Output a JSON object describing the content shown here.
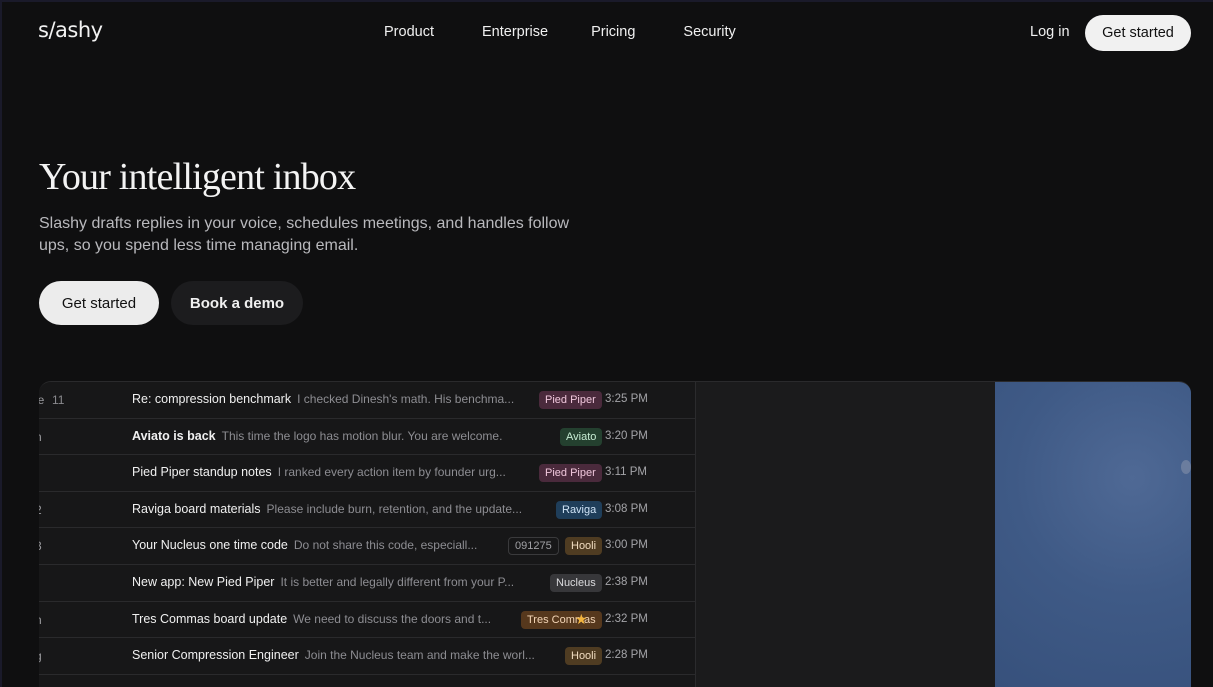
{
  "nav": {
    "logo": "s/ashy",
    "links": [
      "Product",
      "Enterprise",
      "Pricing",
      "Security"
    ],
    "login": "Log in",
    "cta": "Get started"
  },
  "hero": {
    "title": "Your intelligent inbox",
    "subtitle": "Slashy drafts replies in your voice, schedules meetings, and handles follow ups, so you spend less time managing email.",
    "primary_button": "Get started",
    "secondary_button": "Book a demo"
  },
  "emails": [
    {
      "left": "le",
      "count": "11",
      "subject": "Re: compression benchmark",
      "snippet": "I checked Dinesh's math. His benchma...",
      "tag": "Pied Piper",
      "tag_color": "#4a2a3c",
      "tag_text": "#f0c7dc",
      "time": "3:25 PM",
      "bold": false
    },
    {
      "left": "n",
      "count": "",
      "subject": "Aviato is back",
      "snippet": "This time the logo has motion blur. You are welcome.",
      "tag": "Aviato",
      "tag_color": "#24402f",
      "tag_text": "#c6ecd3",
      "time": "3:20 PM",
      "bold": true
    },
    {
      "left": "",
      "count": "",
      "subject": "Pied Piper standup notes",
      "snippet": "I ranked every action item by founder urg...",
      "tag": "Pied Piper",
      "tag_color": "#4a2a3c",
      "tag_text": "#f0c7dc",
      "time": "3:11 PM",
      "bold": false
    },
    {
      "left": "2",
      "count": "",
      "subject": "Raviga board materials",
      "snippet": "Please include burn, retention, and the update...",
      "tag": "Raviga",
      "tag_color": "#1f3e5a",
      "tag_text": "#cfe3f6",
      "time": "3:08 PM",
      "bold": false
    },
    {
      "left": "3",
      "count": "",
      "subject": "Your Nucleus one time code",
      "snippet": "Do not share this code, especiall...",
      "code": "091275",
      "tag": "Hooli",
      "tag_color": "#4f3c22",
      "tag_text": "#f0dcc0",
      "time": "3:00 PM",
      "bold": false
    },
    {
      "left": "",
      "count": "",
      "subject": "New app: New Pied Piper",
      "snippet": "It is better and legally different from your P...",
      "tag": "Nucleus",
      "tag_color": "#37373a",
      "tag_text": "#dcdcdf",
      "time": "2:38 PM",
      "bold": false
    },
    {
      "left": "n",
      "count": "",
      "subject": "Tres Commas board update",
      "snippet": "We need to discuss the doors and t...",
      "tag": "Tres Commas",
      "tag_color": "#56381d",
      "tag_text": "#f4d6b7",
      "star": true,
      "time": "2:32 PM",
      "bold": false
    },
    {
      "left": "g",
      "count": "",
      "subject": "Senior Compression Engineer",
      "snippet": "Join the Nucleus team and make the worl...",
      "tag": "Hooli",
      "tag_color": "#4f3c22",
      "tag_text": "#f0dcc0",
      "time": "2:28 PM",
      "bold": false
    }
  ]
}
